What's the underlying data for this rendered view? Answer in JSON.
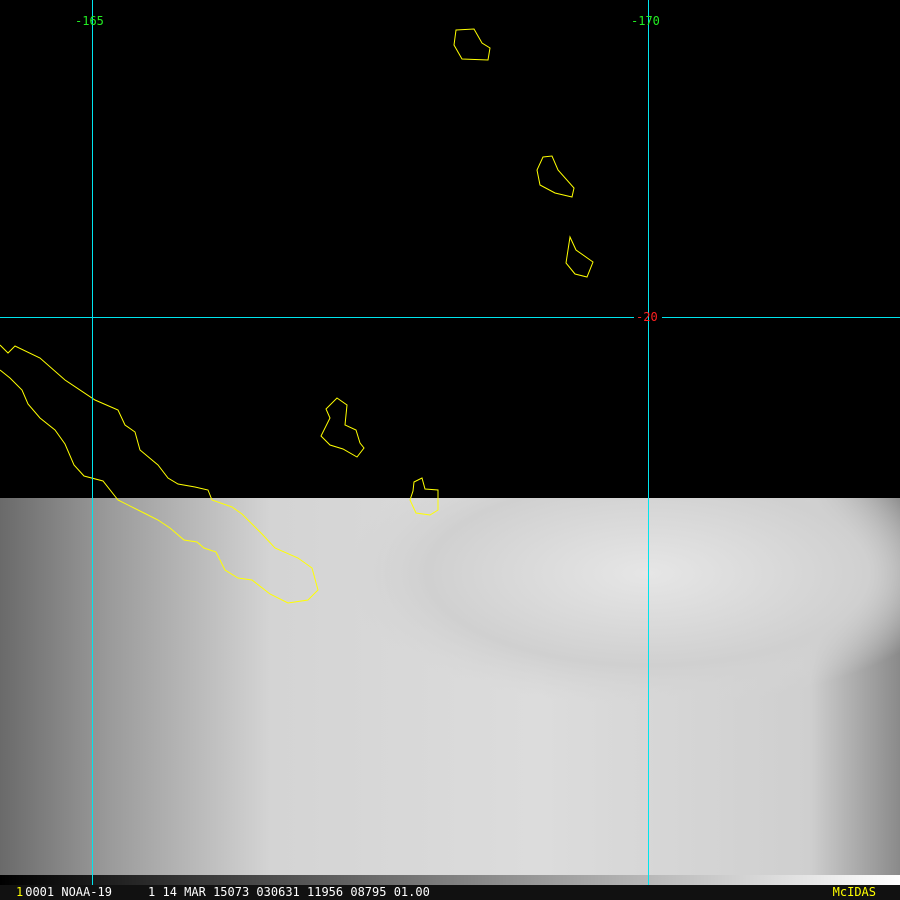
{
  "grid": {
    "lon_labels": [
      "-165",
      "-170"
    ],
    "lat_labels": [
      "-20"
    ],
    "line_color": "#00e5ee",
    "lon_label_color": "#22ee22",
    "lat_label_color": "#ff2020"
  },
  "coastline_color": "#ffff00",
  "status_bar": {
    "frame_number": "1",
    "info": "0001 NOAA-19     1 14 MAR 15073 030631 11956 08795 01.00",
    "brand": "McIDAS"
  }
}
